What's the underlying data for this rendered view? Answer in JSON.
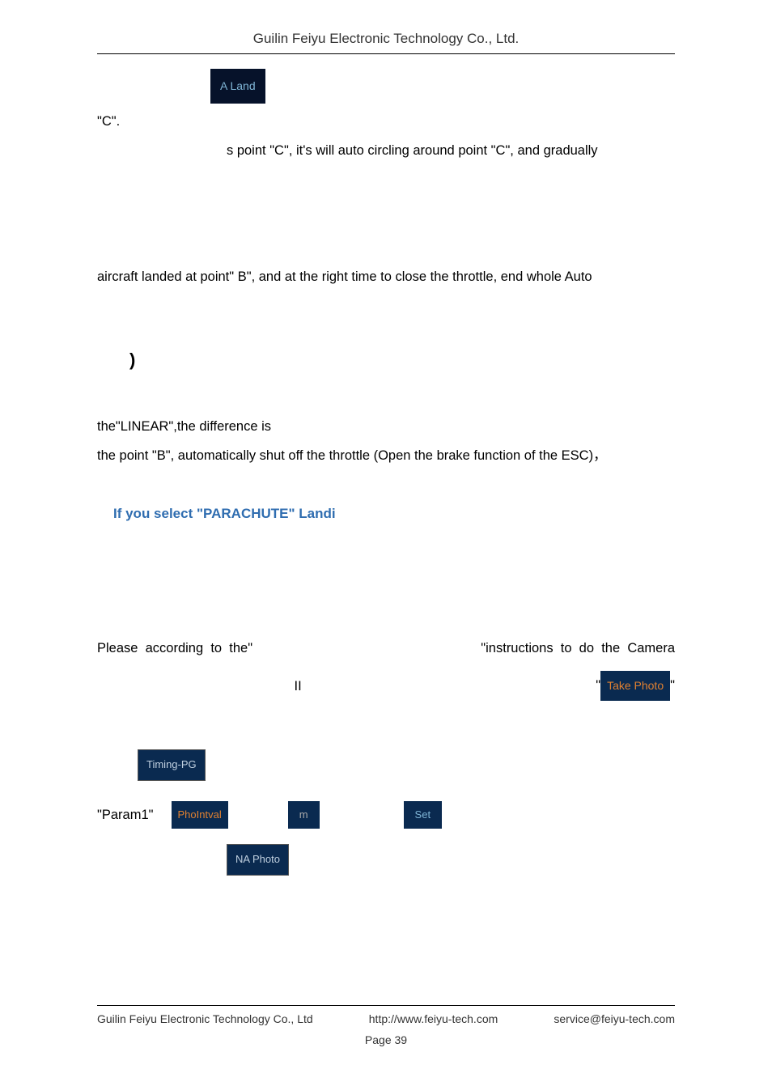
{
  "header": {
    "title": "Guilin Feiyu Electronic Technology Co., Ltd."
  },
  "buttons": {
    "aland": "A Land",
    "takephoto": "Take Photo",
    "timingpg": "Timing-PG",
    "phointval": "PhoIntval",
    "m": "m",
    "set": "Set",
    "naphoto": "NA Photo"
  },
  "body": {
    "line1": "\"C\".",
    "line2": "s point \"C\", it's will auto circling around point \"C\", and gradually",
    "line3": "aircraft landed at point\" B\", and at the right time to close the throttle, end whole Auto",
    "paren": ")",
    "linear1": "the\"LINEAR\",the difference is",
    "linear2": "the point \"B\", automatically shut off the throttle (Open the brake function of the ESC)，",
    "bluetext": "If you select \"PARACHUTE\" Landi",
    "camera_row_pre": "Please  according  to  the\"",
    "camera_row_post": "\"instructions  to  do  the  Camera",
    "roman": "II",
    "param1": "\"Param1\""
  },
  "footer": {
    "company": "Guilin Feiyu Electronic Technology Co., Ltd",
    "url": "http://www.feiyu-tech.com",
    "email": "service@feiyu-tech.com",
    "page": "Page 39"
  }
}
